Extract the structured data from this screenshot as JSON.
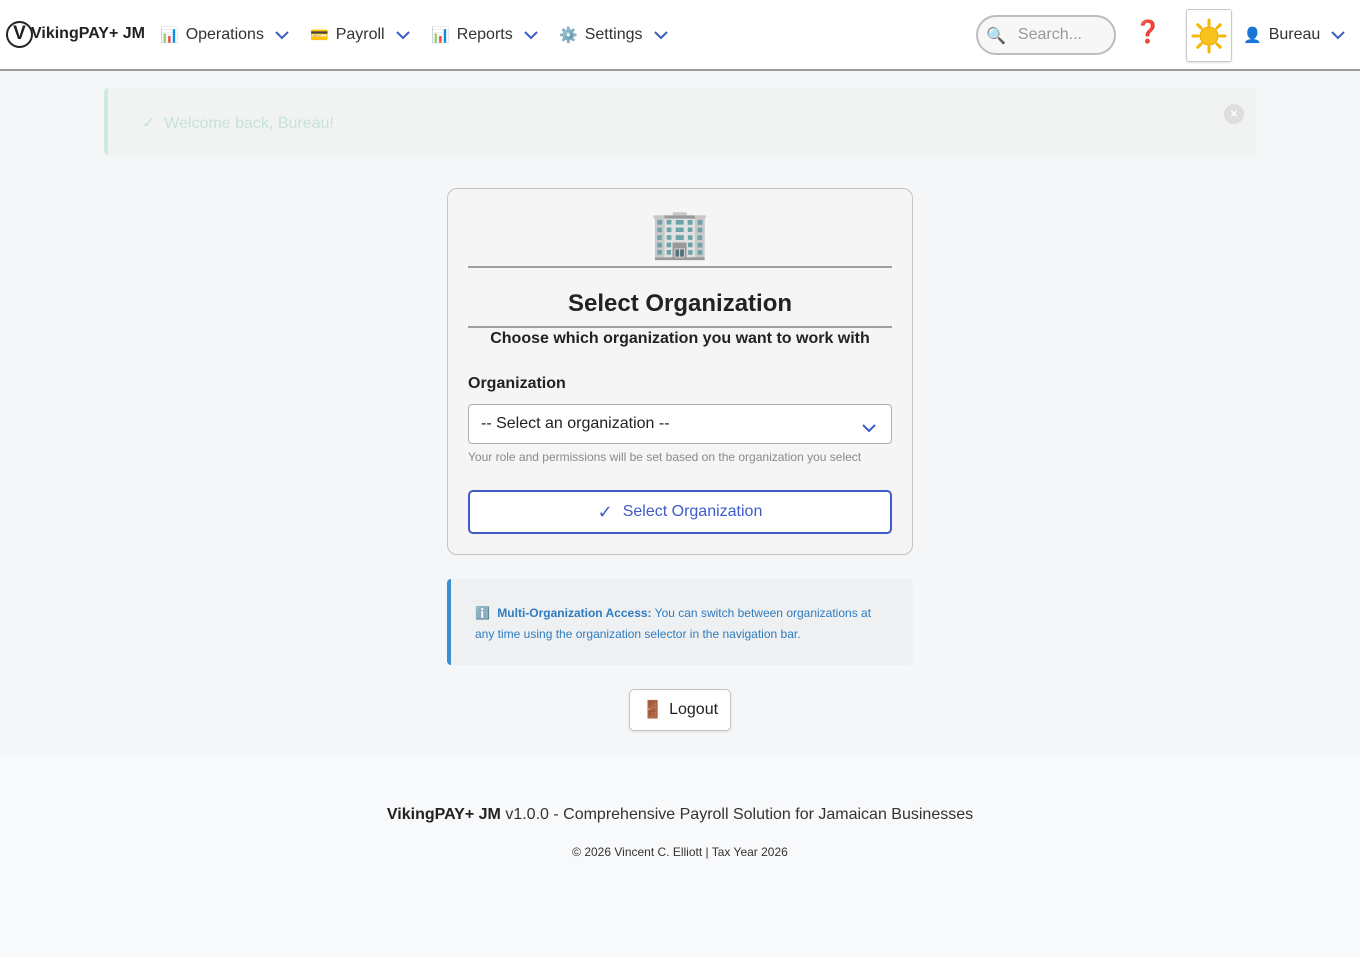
{
  "navbar": {
    "brand_mark": "V",
    "brand": "VikingPAY+ JM",
    "menus": [
      {
        "icon": "📊",
        "label": "Operations"
      },
      {
        "icon": "💳",
        "label": "Payroll"
      },
      {
        "icon": "📊",
        "label": "Reports"
      },
      {
        "icon": "⚙️",
        "label": "Settings"
      }
    ],
    "search_icon": "🔍",
    "search_placeholder": "Search...",
    "help_icon": "❓",
    "theme_icon": "sun-icon",
    "user_icon": "👤",
    "user_label": "Bureau"
  },
  "alert": {
    "check": "✓",
    "message": "Welcome back, Bureau!",
    "close": "×"
  },
  "card": {
    "icon": "🏢",
    "title": "Select Organization",
    "subtitle": "Choose which organization you want to work with",
    "field_label": "Organization",
    "select_value": "-- Select an organization --",
    "help_text": "Your role and permissions will be set based on the organization you select",
    "button_check": "✓",
    "button_label": "Select Organization"
  },
  "info": {
    "icon": "ℹ️",
    "title": "Multi-Organization Access:",
    "text": "You can switch between organizations at any time using the organization selector in the navigation bar."
  },
  "logout": {
    "icon": "🚪",
    "label": "Logout"
  },
  "footer": {
    "brand": "VikingPAY+ JM",
    "tagline": "v1.0.0 - Comprehensive Payroll Solution for Jamaican Businesses",
    "copyright": "© 2026 Vincent C. Elliott | Tax Year 2026"
  },
  "colors": {
    "accent": "#3e5bc8",
    "info": "#2f7cbf",
    "help": "#d6262a",
    "sun": "#f5b800"
  }
}
